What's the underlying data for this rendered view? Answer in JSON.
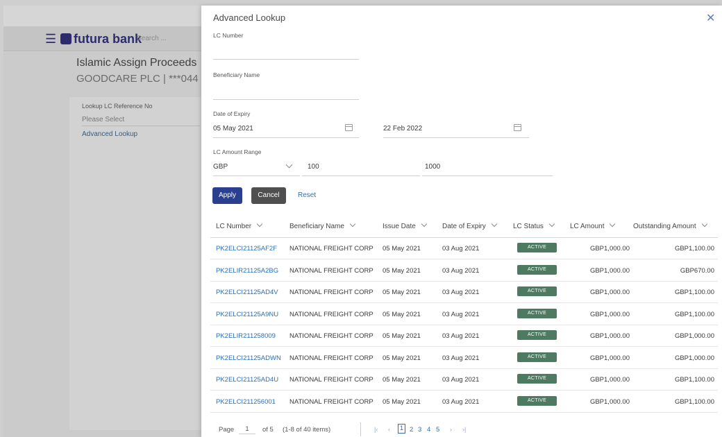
{
  "background": {
    "brand_name": "futura bank",
    "search_placeholder": "Search ...",
    "page_title": "Islamic Assign Proceeds",
    "page_subtitle": "GOODCARE PLC | ***044",
    "lookup_label": "Lookup LC Reference No",
    "lookup_placeholder": "Please Select",
    "advanced_lookup_link": "Advanced Lookup"
  },
  "modal": {
    "title": "Advanced Lookup",
    "close_icon": "close-icon",
    "fields": {
      "lc_number_label": "LC Number",
      "lc_number_value": "",
      "beneficiary_label": "Beneficiary Name",
      "beneficiary_value": "",
      "expiry_label": "Date of Expiry",
      "expiry_from": "05 May 2021",
      "expiry_to": "22 Feb 2022",
      "amount_label": "LC Amount Range",
      "currency": "GBP",
      "amount_from": "100",
      "amount_to": "1000"
    },
    "buttons": {
      "apply": "Apply",
      "cancel": "Cancel",
      "reset": "Reset"
    },
    "table": {
      "headers": [
        "LC Number",
        "Beneficiary Name",
        "Issue Date",
        "Date of Expiry",
        "LC Status",
        "LC Amount",
        "Outstanding Amount"
      ],
      "rows": [
        {
          "lc": "PK2ELCI21125AF2F",
          "ben": "NATIONAL FREIGHT CORP",
          "issue": "05 May 2021",
          "expiry": "03 Aug 2021",
          "status": "ACTIVE",
          "amount": "GBP1,000.00",
          "outstanding": "GBP1,100.00"
        },
        {
          "lc": "PK2ELIR21125A2BG",
          "ben": "NATIONAL FREIGHT CORP",
          "issue": "05 May 2021",
          "expiry": "03 Aug 2021",
          "status": "ACTIVE",
          "amount": "GBP1,000.00",
          "outstanding": "GBP670.00"
        },
        {
          "lc": "PK2ELCI21125AD4V",
          "ben": "NATIONAL FREIGHT CORP",
          "issue": "05 May 2021",
          "expiry": "03 Aug 2021",
          "status": "ACTIVE",
          "amount": "GBP1,000.00",
          "outstanding": "GBP1,100.00"
        },
        {
          "lc": "PK2ELCI21125A9NU",
          "ben": "NATIONAL FREIGHT CORP",
          "issue": "05 May 2021",
          "expiry": "03 Aug 2021",
          "status": "ACTIVE",
          "amount": "GBP1,000.00",
          "outstanding": "GBP1,100.00"
        },
        {
          "lc": "PK2ELIR211258009",
          "ben": "NATIONAL FREIGHT CORP",
          "issue": "05 May 2021",
          "expiry": "03 Aug 2021",
          "status": "ACTIVE",
          "amount": "GBP1,000.00",
          "outstanding": "GBP1,000.00"
        },
        {
          "lc": "PK2ELCI21125ADWN",
          "ben": "NATIONAL FREIGHT CORP",
          "issue": "05 May 2021",
          "expiry": "03 Aug 2021",
          "status": "ACTIVE",
          "amount": "GBP1,000.00",
          "outstanding": "GBP1,000.00"
        },
        {
          "lc": "PK2ELCI21125AD4U",
          "ben": "NATIONAL FREIGHT CORP",
          "issue": "05 May 2021",
          "expiry": "03 Aug 2021",
          "status": "ACTIVE",
          "amount": "GBP1,000.00",
          "outstanding": "GBP1,100.00"
        },
        {
          "lc": "PK2ELCI211256001",
          "ben": "NATIONAL FREIGHT CORP",
          "issue": "05 May 2021",
          "expiry": "03 Aug 2021",
          "status": "ACTIVE",
          "amount": "GBP1,000.00",
          "outstanding": "GBP1,100.00"
        }
      ]
    },
    "pagination": {
      "page_label": "Page",
      "current_page": "1",
      "of_label": "of 5",
      "items_info": "(1-8 of 40 items)",
      "pages": [
        "1",
        "2",
        "3",
        "4",
        "5"
      ]
    }
  }
}
